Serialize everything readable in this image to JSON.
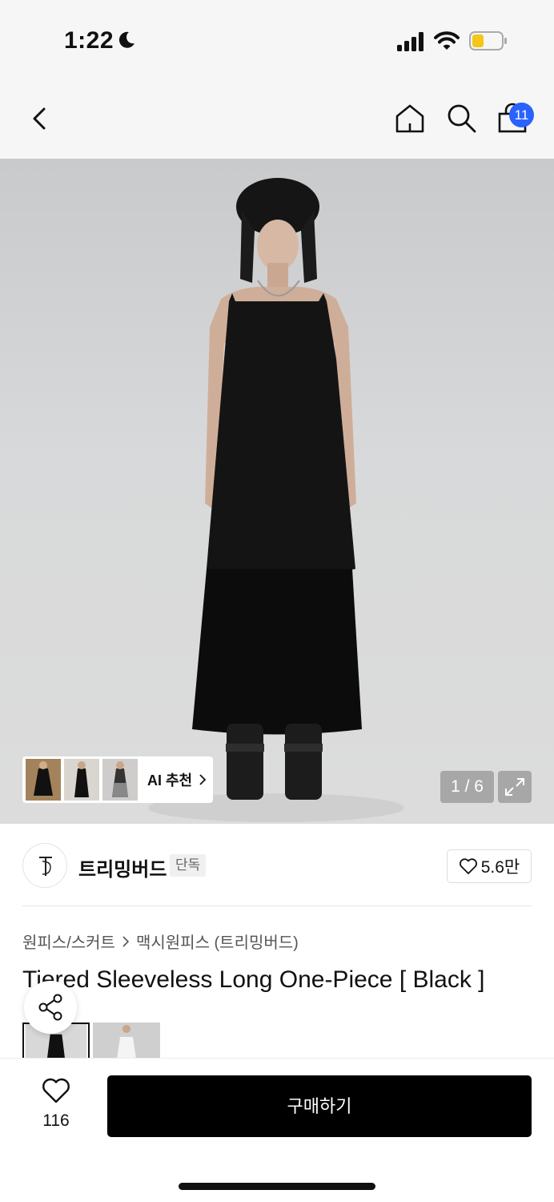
{
  "status_bar": {
    "time": "1:22",
    "moon_icon": "moon-icon",
    "signal_icon": "cellular-signal-icon",
    "wifi_icon": "wifi-icon",
    "battery_icon": "battery-icon",
    "battery_color": "#f5c518"
  },
  "nav": {
    "back_icon": "chevron-left-icon",
    "home_icon": "home-icon",
    "search_icon": "search-icon",
    "cart_icon": "shopping-bag-icon",
    "cart_count": "11",
    "badge_color": "#2962ff"
  },
  "hero": {
    "ai_label": "AI 추천",
    "counter": "1 / 6",
    "expand_icon": "expand-icon"
  },
  "brand": {
    "name": "트리밍버드",
    "tag": "단독",
    "likes": "5.6만",
    "logo_text": "T"
  },
  "breadcrumb": {
    "category": "원피스/스커트",
    "subcategory": "맥시원피스 (트리밍버드)"
  },
  "product": {
    "title": "Tiered Sleeveless Long One-Piece [ Black ]"
  },
  "bottom_bar": {
    "wish_count": "116",
    "buy_label": "구매하기"
  }
}
